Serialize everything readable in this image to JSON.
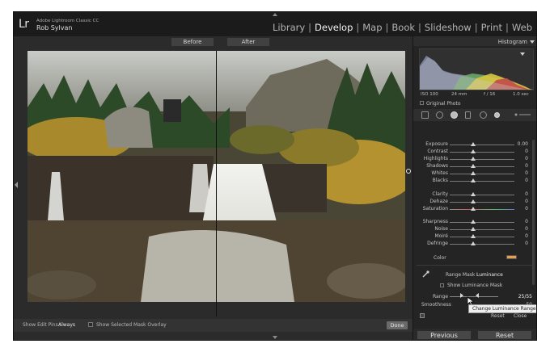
{
  "app": {
    "logo": "Lr",
    "name": "Adobe Lightroom Classic CC",
    "user": "Rob Sylvan"
  },
  "modules": [
    {
      "label": "Library",
      "active": false
    },
    {
      "label": "Develop",
      "active": true
    },
    {
      "label": "Map",
      "active": false
    },
    {
      "label": "Book",
      "active": false
    },
    {
      "label": "Slideshow",
      "active": false
    },
    {
      "label": "Print",
      "active": false
    },
    {
      "label": "Web",
      "active": false
    }
  ],
  "compare": {
    "before_label": "Before",
    "after_label": "After"
  },
  "toolbar": {
    "show_edit_pins_label": "Show Edit Pins :",
    "show_edit_pins_value": "Always",
    "overlay_label": "Show Selected Mask Overlay",
    "done_label": "Done"
  },
  "histogram": {
    "title": "Histogram",
    "iso": "ISO 100",
    "focal": "24 mm",
    "aperture": "f / 16",
    "shutter": "1.0 sec",
    "original_photo_label": "Original Photo"
  },
  "sliders": [
    {
      "label": "Exposure",
      "value": "0.00"
    },
    {
      "label": "Contrast",
      "value": "0"
    },
    {
      "label": "Highlights",
      "value": "0"
    },
    {
      "label": "Shadows",
      "value": "0"
    },
    {
      "label": "Whites",
      "value": "0"
    },
    {
      "label": "Blacks",
      "value": "0"
    },
    {
      "label": "Clarity",
      "value": "0"
    },
    {
      "label": "Dehaze",
      "value": "0"
    },
    {
      "label": "Saturation",
      "value": "0"
    },
    {
      "label": "Sharpness",
      "value": "0"
    },
    {
      "label": "Noise",
      "value": "0"
    },
    {
      "label": "Moiré",
      "value": "0"
    },
    {
      "label": "Defringe",
      "value": "0"
    }
  ],
  "color": {
    "label": "Color",
    "swatch": "#e8a04a"
  },
  "range_mask": {
    "label": "Range Mask :",
    "value": "Luminance",
    "show_luminance_label": "Show Luminance Mask",
    "range_label": "Range",
    "range_value": "25/55",
    "smoothness_label": "Smoothness",
    "smoothness_value": "50",
    "tooltip": "Change Luminance Range.",
    "reset_label": "Reset",
    "close_label": "Close"
  },
  "panel_buttons": {
    "previous": "Previous",
    "reset": "Reset"
  }
}
